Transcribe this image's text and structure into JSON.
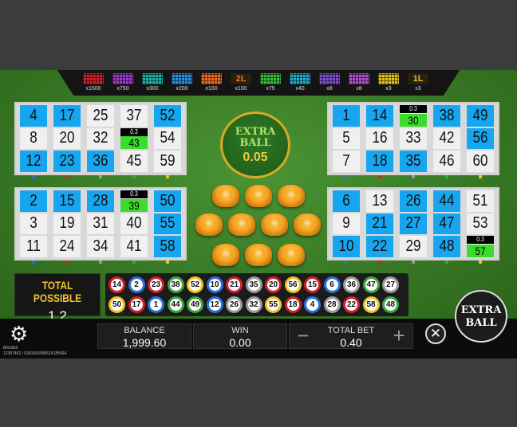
{
  "paytable": [
    {
      "icon": "grid-pattern-icon",
      "color": "#d0202a",
      "mult": "x1500"
    },
    {
      "icon": "grid-pattern-icon",
      "color": "#9c3bcb",
      "mult": "x750"
    },
    {
      "icon": "grid-pattern-icon",
      "color": "#1bb3a6",
      "mult": "x300"
    },
    {
      "icon": "grid-pattern-icon",
      "color": "#2b8ed8",
      "mult": "x200"
    },
    {
      "icon": "grid-pattern-icon",
      "color": "#f06b22",
      "mult": "x100"
    },
    {
      "icon": "2l-pattern-icon",
      "color": "#f06b22",
      "text": "2L",
      "mult": "x100"
    },
    {
      "icon": "grid-pattern-icon",
      "color": "#38b93a",
      "mult": "x75"
    },
    {
      "icon": "grid-pattern-icon",
      "color": "#1faac8",
      "mult": "x40"
    },
    {
      "icon": "grid-pattern-icon",
      "color": "#7c4fd0",
      "mult": "x8"
    },
    {
      "icon": "grid-pattern-icon",
      "color": "#b050c8",
      "mult": "x8"
    },
    {
      "icon": "grid-pattern-icon",
      "color": "#e0c020",
      "mult": "x3"
    },
    {
      "icon": "1l-pattern-icon",
      "color": "#e0c020",
      "text": "1L",
      "mult": "x3"
    }
  ],
  "cards": [
    {
      "cells": [
        {
          "n": "4",
          "blue": true
        },
        {
          "n": "17",
          "blue": true
        },
        {
          "n": "25",
          "blue": false
        },
        {
          "n": "37",
          "blue": false
        },
        {
          "n": "52",
          "blue": true
        },
        {
          "n": "8",
          "blue": false
        },
        {
          "n": "20",
          "blue": false
        },
        {
          "n": "32",
          "blue": false
        },
        {
          "n": "43",
          "blue": false,
          "prize": "0.3"
        },
        {
          "n": "54",
          "blue": false
        },
        {
          "n": "12",
          "blue": true
        },
        {
          "n": "23",
          "blue": true
        },
        {
          "n": "36",
          "blue": true
        },
        {
          "n": "45",
          "blue": false
        },
        {
          "n": "59",
          "blue": false
        }
      ]
    },
    {
      "cells": [
        {
          "n": "1",
          "blue": true
        },
        {
          "n": "14",
          "blue": true
        },
        {
          "n": "30",
          "blue": false,
          "prize": "0.3"
        },
        {
          "n": "38",
          "blue": true
        },
        {
          "n": "49",
          "blue": true
        },
        {
          "n": "5",
          "blue": false
        },
        {
          "n": "16",
          "blue": false
        },
        {
          "n": "33",
          "blue": false
        },
        {
          "n": "42",
          "blue": false
        },
        {
          "n": "56",
          "blue": true
        },
        {
          "n": "7",
          "blue": false
        },
        {
          "n": "18",
          "blue": true
        },
        {
          "n": "35",
          "blue": true
        },
        {
          "n": "46",
          "blue": false
        },
        {
          "n": "60",
          "blue": false
        }
      ]
    },
    {
      "cells": [
        {
          "n": "2",
          "blue": true
        },
        {
          "n": "15",
          "blue": true
        },
        {
          "n": "28",
          "blue": true
        },
        {
          "n": "39",
          "blue": false,
          "prize": "0.3"
        },
        {
          "n": "50",
          "blue": true
        },
        {
          "n": "3",
          "blue": false
        },
        {
          "n": "19",
          "blue": false
        },
        {
          "n": "31",
          "blue": false
        },
        {
          "n": "40",
          "blue": false
        },
        {
          "n": "55",
          "blue": true
        },
        {
          "n": "11",
          "blue": false
        },
        {
          "n": "24",
          "blue": false
        },
        {
          "n": "34",
          "blue": false
        },
        {
          "n": "41",
          "blue": false
        },
        {
          "n": "58",
          "blue": true
        }
      ]
    },
    {
      "cells": [
        {
          "n": "6",
          "blue": true
        },
        {
          "n": "13",
          "blue": false
        },
        {
          "n": "26",
          "blue": true
        },
        {
          "n": "44",
          "blue": true
        },
        {
          "n": "51",
          "blue": false
        },
        {
          "n": "9",
          "blue": false
        },
        {
          "n": "21",
          "blue": true
        },
        {
          "n": "27",
          "blue": true
        },
        {
          "n": "47",
          "blue": true
        },
        {
          "n": "53",
          "blue": false
        },
        {
          "n": "10",
          "blue": true
        },
        {
          "n": "22",
          "blue": true
        },
        {
          "n": "29",
          "blue": false
        },
        {
          "n": "48",
          "blue": true
        },
        {
          "n": "57",
          "blue": false,
          "prize": "0.3"
        }
      ]
    }
  ],
  "extra_ball_badge": {
    "title": "EXTRA BALL",
    "value": "0.05"
  },
  "total_possible": {
    "label": "TOTAL POSSIBLE",
    "value": "1.2"
  },
  "drawn_balls": [
    {
      "n": "14",
      "color": "#d0202a"
    },
    {
      "n": "2",
      "color": "#2b6fd8"
    },
    {
      "n": "23",
      "color": "#d0202a"
    },
    {
      "n": "38",
      "color": "#38a83a"
    },
    {
      "n": "52",
      "color": "#f0c420"
    },
    {
      "n": "10",
      "color": "#2b6fd8"
    },
    {
      "n": "21",
      "color": "#d0202a"
    },
    {
      "n": "35",
      "color": "#9a9a9a"
    },
    {
      "n": "20",
      "color": "#d0202a"
    },
    {
      "n": "56",
      "color": "#f0c420"
    },
    {
      "n": "15",
      "color": "#d0202a"
    },
    {
      "n": "6",
      "color": "#2b6fd8"
    },
    {
      "n": "36",
      "color": "#9a9a9a"
    },
    {
      "n": "47",
      "color": "#38a83a"
    },
    {
      "n": "27",
      "color": "#9a9a9a"
    },
    {
      "n": "50",
      "color": "#f0c420"
    },
    {
      "n": "17",
      "color": "#d0202a"
    },
    {
      "n": "1",
      "color": "#2b6fd8"
    },
    {
      "n": "44",
      "color": "#38a83a"
    },
    {
      "n": "49",
      "color": "#38a83a"
    },
    {
      "n": "12",
      "color": "#2b6fd8"
    },
    {
      "n": "26",
      "color": "#9a9a9a"
    },
    {
      "n": "32",
      "color": "#9a9a9a"
    },
    {
      "n": "55",
      "color": "#f0c420"
    },
    {
      "n": "18",
      "color": "#d0202a"
    },
    {
      "n": "4",
      "color": "#2b6fd8"
    },
    {
      "n": "28",
      "color": "#9a9a9a"
    },
    {
      "n": "22",
      "color": "#d0202a"
    },
    {
      "n": "58",
      "color": "#f0c420"
    },
    {
      "n": "48",
      "color": "#38a83a"
    }
  ],
  "footer": {
    "info_line1": "80x58ck",
    "info_line2": "12397462 / 0303306090615185664",
    "balance_label": "BALANCE",
    "balance": "1,999.60",
    "win_label": "WIN",
    "win": "0.00",
    "bet_label": "TOTAL BET",
    "bet": "0.40",
    "minus": "−",
    "plus": "+",
    "close": "✕",
    "extra_ball_button": "EXTRA BALL"
  }
}
